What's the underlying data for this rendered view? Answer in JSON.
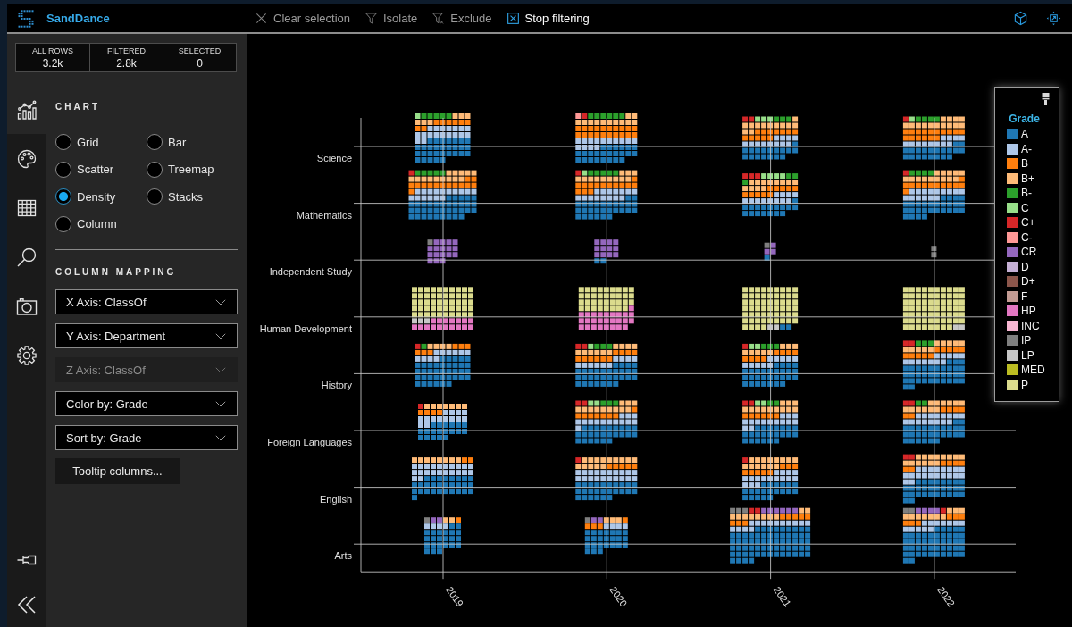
{
  "app": {
    "title": "SandDance"
  },
  "toolbar": [
    {
      "kind": "clear",
      "label": "Clear selection",
      "disabled": true
    },
    {
      "kind": "isolate",
      "label": "Isolate",
      "disabled": true
    },
    {
      "kind": "exclude",
      "label": "Exclude",
      "disabled": true
    },
    {
      "kind": "stop",
      "label": "Stop filtering",
      "disabled": false
    }
  ],
  "stats": [
    {
      "label": "ALL ROWS",
      "value": "3.2k"
    },
    {
      "label": "FILTERED",
      "value": "2.8k"
    },
    {
      "label": "SELECTED",
      "value": "0"
    }
  ],
  "sidebar_tabs": [
    {
      "kind": "chart",
      "selected": true
    },
    {
      "kind": "color",
      "selected": false
    },
    {
      "kind": "data",
      "selected": false
    },
    {
      "kind": "search",
      "selected": false
    },
    {
      "kind": "snapshot",
      "selected": false
    },
    {
      "kind": "settings",
      "selected": false
    }
  ],
  "chart_panel": {
    "heading": "CHART",
    "chart_types": [
      {
        "label": "Grid",
        "selected": false
      },
      {
        "label": "Bar",
        "selected": false
      },
      {
        "label": "Scatter",
        "selected": false
      },
      {
        "label": "Treemap",
        "selected": false
      },
      {
        "label": "Density",
        "selected": true
      },
      {
        "label": "Stacks",
        "selected": false
      },
      {
        "label": "Column",
        "selected": false
      }
    ],
    "mapping_heading": "COLUMN MAPPING",
    "mappings": [
      {
        "value": "X Axis: ClassOf",
        "disabled": false
      },
      {
        "value": "Y Axis: Department",
        "disabled": false
      },
      {
        "value": "Z Axis: ClassOf",
        "disabled": true
      },
      {
        "value": "Color by: Grade",
        "disabled": false
      },
      {
        "value": "Sort by: Grade",
        "disabled": false
      }
    ],
    "button": "Tooltip columns..."
  },
  "plot": {
    "y_labels": [
      "Science",
      "Mathematics",
      "Independent Study",
      "Human Development",
      "History",
      "Foreign Languages",
      "English",
      "Arts"
    ],
    "x_labels": [
      "2019",
      "2020",
      "2021",
      "2022"
    ]
  },
  "legend": {
    "title": "Grade",
    "items": [
      {
        "label": "A",
        "color": "#1f77b4"
      },
      {
        "label": "A-",
        "color": "#aec7e8"
      },
      {
        "label": "B",
        "color": "#ff7f0e"
      },
      {
        "label": "B+",
        "color": "#ffbb78"
      },
      {
        "label": "B-",
        "color": "#2ca02c"
      },
      {
        "label": "C",
        "color": "#98df8a"
      },
      {
        "label": "C+",
        "color": "#d62728"
      },
      {
        "label": "C-",
        "color": "#ff9896"
      },
      {
        "label": "CR",
        "color": "#9467bd"
      },
      {
        "label": "D",
        "color": "#c5b0d5"
      },
      {
        "label": "D+",
        "color": "#8c564b"
      },
      {
        "label": "F",
        "color": "#c49c94"
      },
      {
        "label": "HP",
        "color": "#e377c2"
      },
      {
        "label": "INC",
        "color": "#f7b6d2"
      },
      {
        "label": "IP",
        "color": "#7f7f7f"
      },
      {
        "label": "LP",
        "color": "#c7c7c7"
      },
      {
        "label": "MED",
        "color": "#bcbd22"
      },
      {
        "label": "P",
        "color": "#dbdb8d"
      }
    ]
  }
}
